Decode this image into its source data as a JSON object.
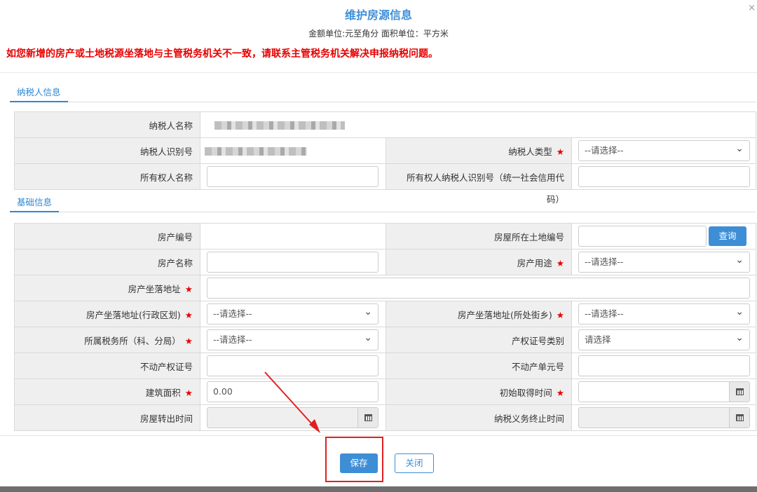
{
  "dialog": {
    "title": "维护房源信息",
    "subtitle": "金额单位:元至角分 面积单位：平方米",
    "warning": "如您新增的房产或土地税源坐落地与主管税务机关不一致，请联系主管税务机关解决申报纳税问题。"
  },
  "taxpayer_section": {
    "tab_label": "纳税人信息",
    "name_label": "纳税人名称",
    "id_label": "纳税人识别号",
    "type_label": "纳税人类型",
    "type_value": "--请选择--",
    "owner_name_label": "所有权人名称",
    "owner_id_label": "所有权人纳税人识别号（统一社会信用代",
    "owner_id_label_tail": "码）"
  },
  "basic_section": {
    "tab_label": "基础信息",
    "property_no_label": "房产编号",
    "land_no_label": "房屋所在土地编号",
    "query_button": "查询",
    "property_name_label": "房产名称",
    "usage_label": "房产用途",
    "usage_value": "--请选择--",
    "address_label": "房产坐落地址",
    "district_label": "房产坐落地址(行政区划)",
    "district_value": "--请选择--",
    "street_label": "房产坐落地址(所处街乡)",
    "street_value": "--请选择--",
    "tax_office_label": "所属税务所（科、分局）",
    "tax_office_value": "--请选择--",
    "cert_type_label": "产权证号类别",
    "cert_type_value": "请选择",
    "cert_no_label": "不动产权证号",
    "unit_no_label": "不动产单元号",
    "area_label": "建筑面积",
    "area_value": "0.00",
    "acquire_time_label": "初始取得时间",
    "transfer_time_label": "房屋转出时间",
    "end_time_label": "纳税义务终止时间"
  },
  "footer": {
    "save_button": "保存",
    "close_button": "关闭"
  },
  "colors": {
    "accent": "#3e8ed6",
    "warning": "#e60000",
    "required": "#e50000",
    "highlight": "#e02020"
  }
}
